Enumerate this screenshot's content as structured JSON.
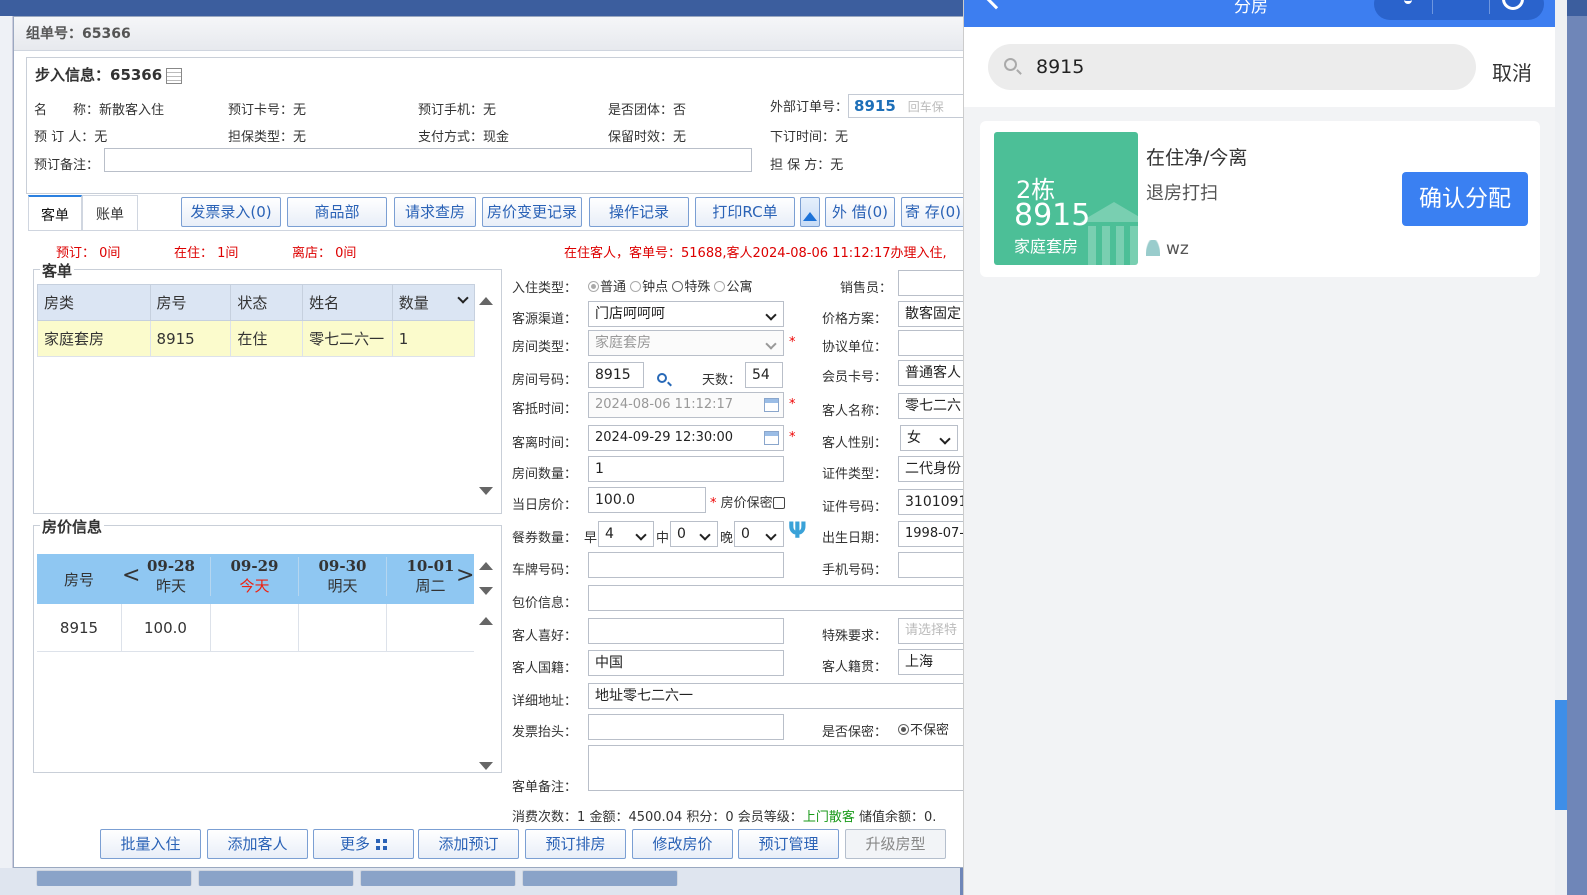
{
  "dialog": {
    "title": "组单号：65366"
  },
  "booking": {
    "legend": "步入信息：65366",
    "name_label": "名　　称：",
    "name": "新散客入住",
    "card_label": "预订卡号：",
    "card": "无",
    "phone_label": "预订手机：",
    "phone": "无",
    "group_label": "是否团体：",
    "group": "否",
    "ext_label": "外部订单号：",
    "ext_value": "8915",
    "ext_placeholder": "回车保",
    "booker_label": "预 订 人：",
    "booker": "无",
    "guarantee_type_label": "担保类型：",
    "guarantee_type": "无",
    "pay_label": "支付方式：",
    "pay": "现金",
    "hold_label": "保留时效：",
    "hold": "无",
    "order_time_label": "下订时间：",
    "order_time": "无",
    "remark_label": "预订备注：",
    "guarantor_label": "担 保 方：",
    "guarantor": "无"
  },
  "tabs": [
    "客单",
    "账单"
  ],
  "toolbar": [
    "发票录入(0)",
    "商品部",
    "请求查房",
    "房价变更记录",
    "操作记录",
    "打印RC单",
    "外 借(0)",
    "寄 存(0)"
  ],
  "stats": {
    "reserved": "预订：  0间",
    "in_house": "在住：  1间",
    "left": "离店：  0间"
  },
  "notice": "在住客人，客单号：51688,客人2024-08-06 11:12:17办理入住,",
  "guest_list": {
    "legend": "客单",
    "headers": [
      "房类",
      "房号",
      "状态",
      "姓名",
      "数量"
    ],
    "rows": [
      [
        "家庭套房",
        "8915",
        "在住",
        "零七二六一",
        "1"
      ]
    ]
  },
  "rate_info": {
    "legend": "房价信息",
    "room_header": "房号",
    "days": [
      {
        "date": "09-28",
        "label": "昨天"
      },
      {
        "date": "09-29",
        "label": "今天"
      },
      {
        "date": "09-30",
        "label": "明天"
      },
      {
        "date": "10-01",
        "label": "周二"
      }
    ],
    "row_room": "8915",
    "row_price": "100.0"
  },
  "form": {
    "checkin_type_label": "入住类型：",
    "checkin_types": [
      "普通",
      "钟点",
      "特殊",
      "公寓"
    ],
    "sales_label": "销售员：",
    "source_label": "客源渠道：",
    "source": "门店呵呵呵",
    "price_plan_label": "价格方案：",
    "price_plan": "散客固定",
    "room_type_label": "房间类型：",
    "room_type": "家庭套房",
    "agreement_label": "协议单位：",
    "room_no_label": "房间号码：",
    "room_no": "8915",
    "days_label": "天数：",
    "days": "54",
    "member_label": "会员卡号：",
    "member": "普通客人",
    "arrive_label": "客抵时间：",
    "arrive": "2024-08-06 11:12:17",
    "guest_name_label": "客人名称：",
    "guest_name": "零七二六",
    "depart_label": "客离时间：",
    "depart": "2024-09-29 12:30:00",
    "gender_label": "客人性别：",
    "gender": "女",
    "room_count_label": "房间数量：",
    "room_count": "1",
    "id_type_label": "证件类型：",
    "id_type": "二代身份",
    "price_label": "当日房价：",
    "price": "100.0",
    "price_secret_label": "房价保密",
    "id_no_label": "证件号码：",
    "id_no": "3101091",
    "meal_label": "餐券数量：",
    "meal_b_label": "早",
    "meal_b": "4",
    "meal_l_label": "中",
    "meal_l": "0",
    "meal_d_label": "晚",
    "meal_d": "0",
    "birth_label": "出生日期：",
    "birth": "1998-07-",
    "plate_label": "车牌号码：",
    "mobile_label": "手机号码：",
    "package_label": "包价信息：",
    "pref_label": "客人喜好：",
    "special_label": "特殊要求：",
    "special_placeholder": "请选择特",
    "nationality_label": "客人国籍：",
    "nationality": "中国",
    "native_label": "客人籍贯：",
    "native": "上海",
    "address_label": "详细地址：",
    "address": "地址零七二六一",
    "invoice_label": "发票抬头：",
    "secret_label": "是否保密：",
    "secret_opt": "不保密",
    "remark_label": "客单备注："
  },
  "footer_stats": {
    "visits_label": "消费次数：",
    "visits": "1",
    "amount_label": "金额：",
    "amount": "4500.04",
    "points_label": "积分：",
    "points": "0",
    "level_label": "会员等级：",
    "level": "上门散客",
    "balance_label": "储值余额：",
    "balance": "0."
  },
  "bottom_buttons": [
    "批量入住",
    "添加客人",
    "更多",
    "添加预订",
    "预订排房",
    "修改房价",
    "预订管理",
    "升级房型"
  ],
  "mobile": {
    "title": "分房",
    "search_value": "8915",
    "cancel": "取消",
    "building": "2栋",
    "room_no": "8915",
    "room_type": "家庭套房",
    "status": "在住净/今离",
    "sub_status": "退房打扫",
    "user": "wz",
    "confirm": "确认分配",
    "colors": {
      "header": "#3d7ef0",
      "tile": "#4cbf97",
      "confirm": "#3a80f2"
    }
  }
}
